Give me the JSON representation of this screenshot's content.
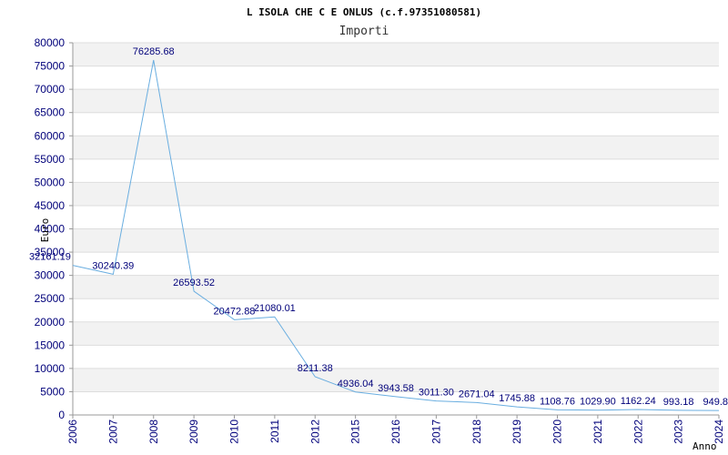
{
  "chart_data": {
    "type": "line",
    "title": "L ISOLA CHE C E ONLUS (c.f.97351080581)",
    "subtitle": "Importi",
    "xlabel": "Anno",
    "ylabel": "Euro",
    "ylim": [
      0,
      80000
    ],
    "yticks": [
      0,
      5000,
      10000,
      15000,
      20000,
      25000,
      30000,
      35000,
      40000,
      45000,
      50000,
      55000,
      60000,
      65000,
      70000,
      75000,
      80000
    ],
    "grid": true,
    "categories": [
      "2006",
      "2007",
      "2008",
      "2009",
      "2010",
      "2011",
      "2012",
      "2015",
      "2016",
      "2017",
      "2018",
      "2019",
      "2020",
      "2021",
      "2022",
      "2023",
      "2024"
    ],
    "values": [
      32161.19,
      30240.39,
      76285.68,
      26593.52,
      20472.88,
      21080.01,
      8211.38,
      4936.04,
      3943.58,
      3011.3,
      2671.04,
      1745.88,
      1108.76,
      1029.9,
      1162.24,
      993.18,
      949.8
    ],
    "data_labels": [
      "32161.19",
      "30240.39",
      "76285.68",
      "26593.52",
      "20472.88",
      "21080.01",
      "8211.38",
      "4936.04",
      "3943.58",
      "3011.30",
      "2671.04",
      "1745.88",
      "1108.76",
      "1029.90",
      "1162.24",
      "993.18",
      "949.8"
    ],
    "colors": {
      "line": "#6aaee0",
      "band": "#f2f2f2",
      "grid": "#dddddd",
      "tick_text": "#00007a"
    }
  }
}
